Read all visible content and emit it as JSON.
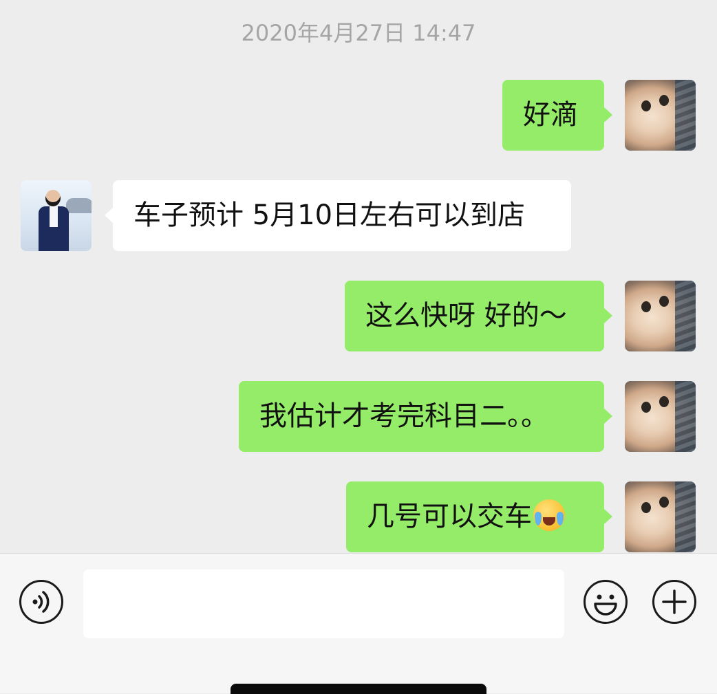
{
  "chat": {
    "timestamp": "2020年4月27日 14:47",
    "messages": [
      {
        "side": "right",
        "sender": "me",
        "text": "好滴",
        "avatar_icon": "cat-avatar"
      },
      {
        "side": "left",
        "sender": "agent",
        "text": "车子预计 5月10日左右可以到店",
        "avatar_icon": "salesman-avatar"
      },
      {
        "side": "right",
        "sender": "me",
        "text": "这么快呀 好的～",
        "avatar_icon": "cat-avatar"
      },
      {
        "side": "right",
        "sender": "me",
        "text": "我估计才考完科目二。。",
        "avatar_icon": "cat-avatar"
      },
      {
        "side": "right",
        "sender": "me",
        "text": "几号可以交车",
        "emoji": "crying-laughing-emoji",
        "avatar_icon": "cat-avatar"
      }
    ]
  },
  "input_bar": {
    "voice_icon": "voice-input-icon",
    "text_value": "",
    "emoji_icon": "smiley-icon",
    "more_icon": "plus-icon"
  },
  "colors": {
    "chat_background": "#ededed",
    "outgoing_bubble": "#95ec69",
    "incoming_bubble": "#ffffff",
    "timestamp_text": "#a5a5a5",
    "input_bar_background": "#f6f6f6"
  }
}
